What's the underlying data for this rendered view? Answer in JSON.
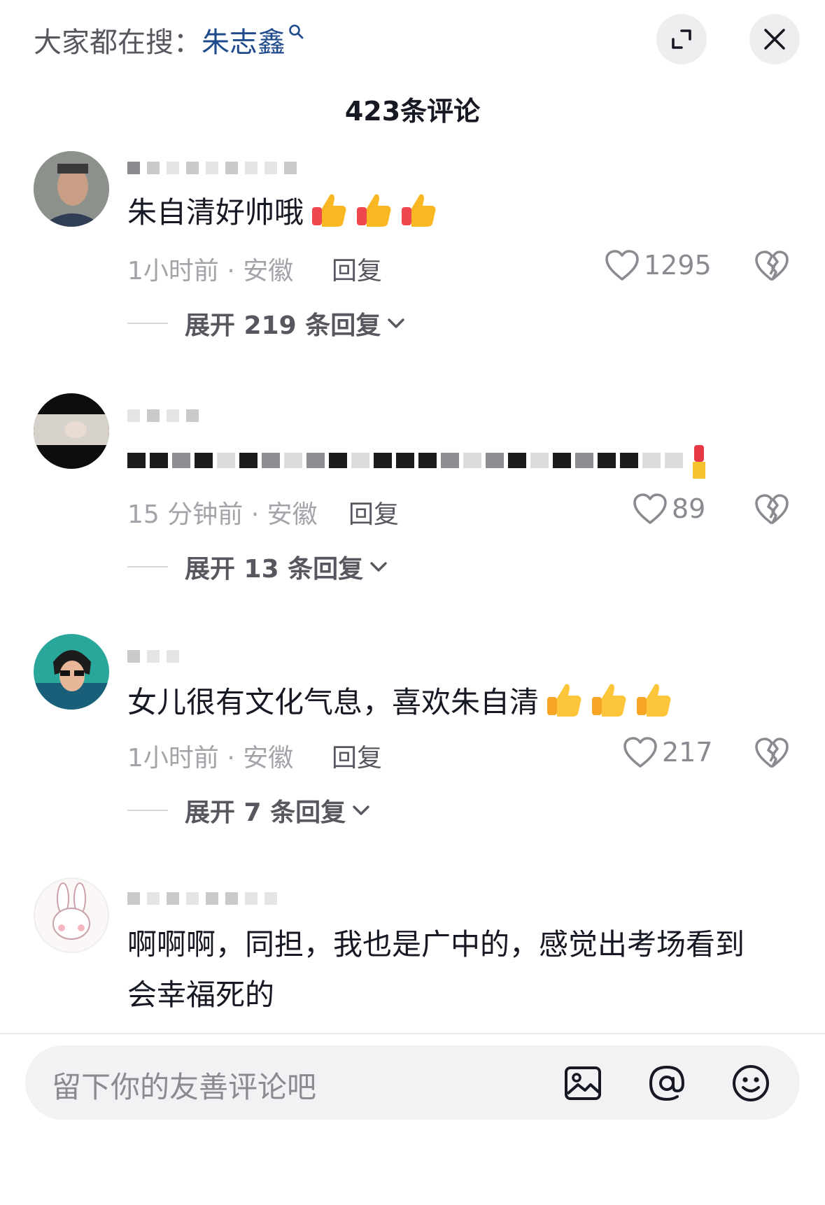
{
  "header": {
    "search_prefix": "大家都在搜：",
    "search_keyword": "朱志鑫"
  },
  "comment_count": "423条评论",
  "comments": [
    {
      "text": "朱自清好帅哦",
      "emoji": "thumbs-up-red x3",
      "time_location": "1小时前 · 安徽",
      "reply_label": "回复",
      "likes": "1295",
      "expand_label": "展开 219 条回复"
    },
    {
      "text": "",
      "time_location": "15 分钟前 · 安徽",
      "reply_label": "回复",
      "likes": "89",
      "expand_label": "展开 13 条回复"
    },
    {
      "text": "女儿很有文化气息，喜欢朱自清",
      "emoji": "thumbs-up-yellow x3",
      "time_location": "1小时前 · 安徽",
      "reply_label": "回复",
      "likes": "217",
      "expand_label": "展开 7 条回复"
    },
    {
      "text_line1": "啊啊啊，同担，我也是广中的，感觉出考场看到",
      "text_line2": "会幸福死的"
    }
  ],
  "input": {
    "placeholder": "留下你的友善评论吧"
  },
  "icons": [
    "search-icon",
    "expand-icon",
    "close-icon",
    "heart-icon",
    "broken-heart-icon",
    "chevron-down-icon",
    "image-icon",
    "at-icon",
    "emoji-icon"
  ],
  "colors": {
    "keyword": "#1f4a8c",
    "text": "#161823",
    "secondary": "#a3a4a9",
    "input_bg": "#f2f2f4"
  }
}
